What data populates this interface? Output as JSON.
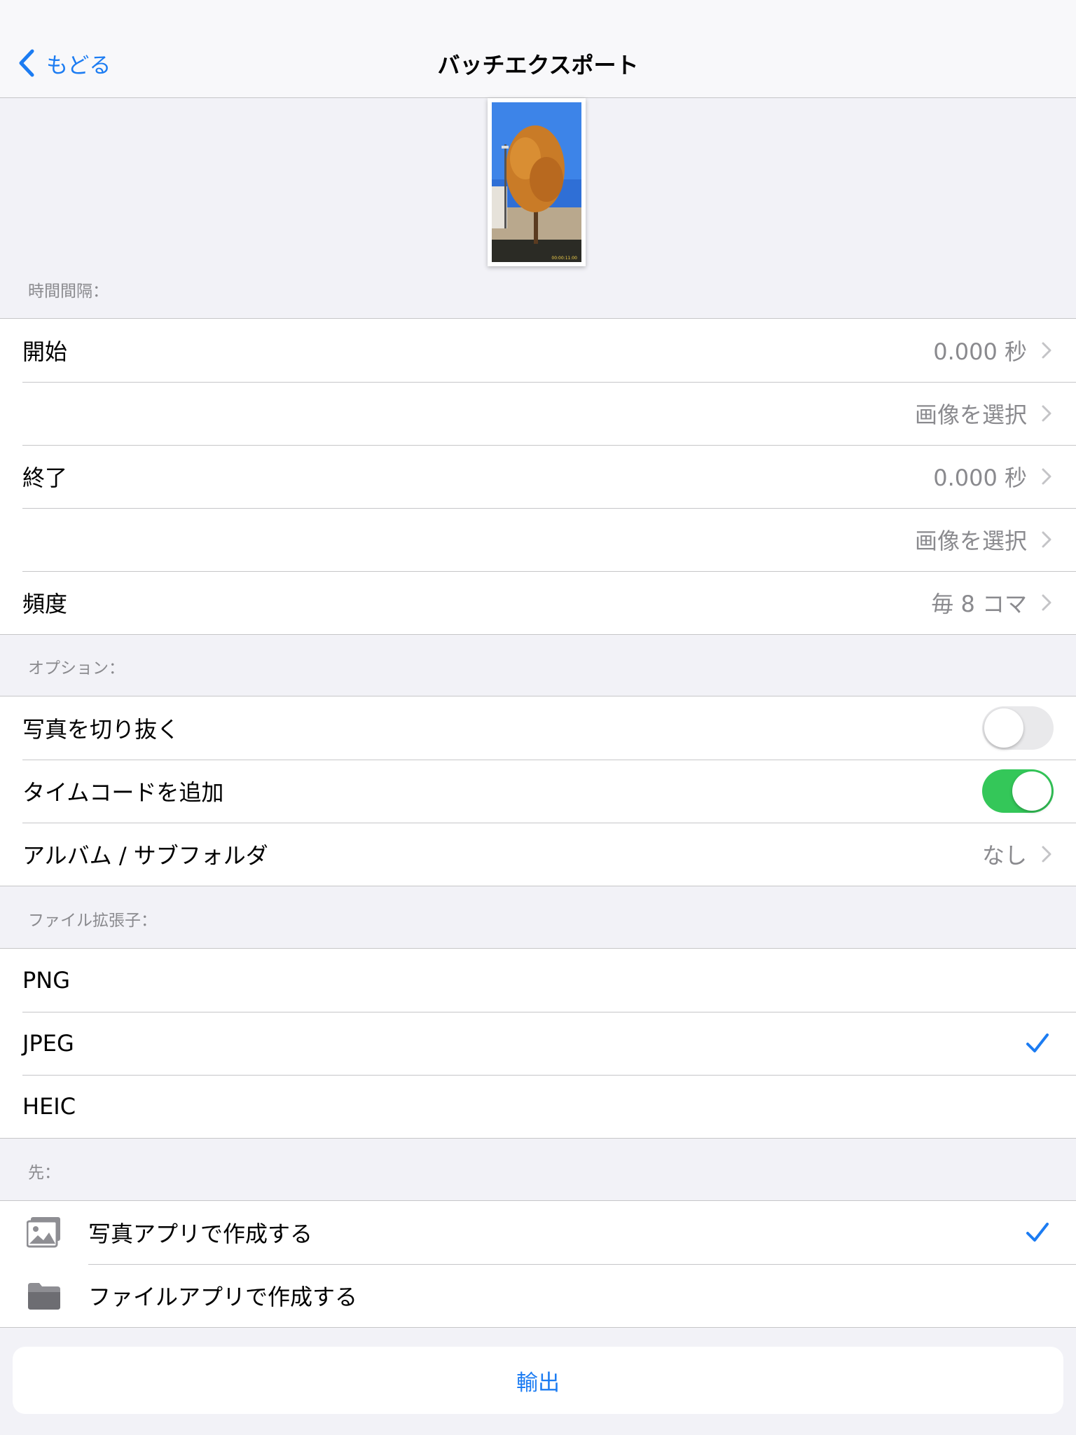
{
  "nav": {
    "back_label": "もどる",
    "title": "バッチエクスポート"
  },
  "thumbnail": {
    "icon": "photo-thumbnail-tree"
  },
  "sections": {
    "interval_header": "時間間隔：",
    "options_header": "オプション：",
    "extension_header": "ファイル拡張子：",
    "destination_header": "先："
  },
  "interval": {
    "start_label": "開始",
    "start_value": "0.000 秒",
    "start_select": "画像を選択",
    "end_label": "終了",
    "end_value": "0.000 秒",
    "end_select": "画像を選択",
    "frequency_label": "頻度",
    "frequency_value": "毎 8 コマ"
  },
  "options": {
    "crop_label": "写真を切り抜く",
    "crop_on": false,
    "timecode_label": "タイムコードを追加",
    "timecode_on": true,
    "album_label": "アルバム / サブフォルダ",
    "album_value": "なし"
  },
  "extensions": {
    "png": "PNG",
    "jpeg": "JPEG",
    "heic": "HEIC",
    "selected": "JPEG"
  },
  "destination": {
    "photos_label": "写真アプリで作成する",
    "files_label": "ファイルアプリで作成する",
    "selected": "photos"
  },
  "export_label": "輸出",
  "colors": {
    "accent": "#1c7cf2",
    "toggle_on": "#34c759",
    "secondary_text": "#8a8a8e",
    "background": "#f2f2f7"
  }
}
